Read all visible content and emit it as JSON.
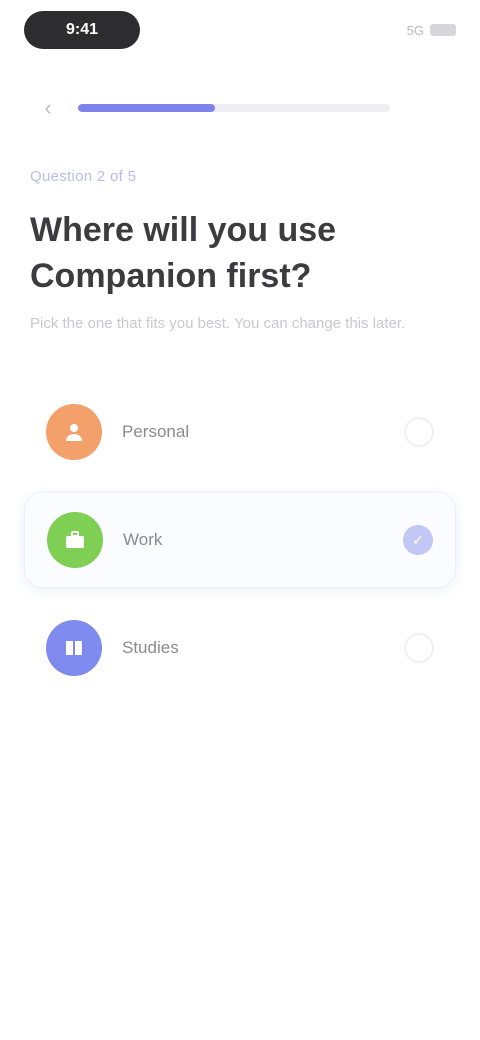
{
  "status_bar": {
    "time": "9:41",
    "signal_text": "5G"
  },
  "progress": {
    "fraction": 0.44
  },
  "question": {
    "step_label": "Question 2 of 5",
    "title": "Where will you use Companion first?",
    "subtitle": "Pick the one that fits you best. You can change this later."
  },
  "options": [
    {
      "label": "Personal",
      "icon": "person-icon",
      "color": "#f3a06a",
      "selected": false
    },
    {
      "label": "Work",
      "icon": "briefcase-icon",
      "color": "#7fcf55",
      "selected": true
    },
    {
      "label": "Studies",
      "icon": "book-icon",
      "color": "#7e8aee",
      "selected": false
    }
  ],
  "colors": {
    "accent": "#7f84ec"
  }
}
